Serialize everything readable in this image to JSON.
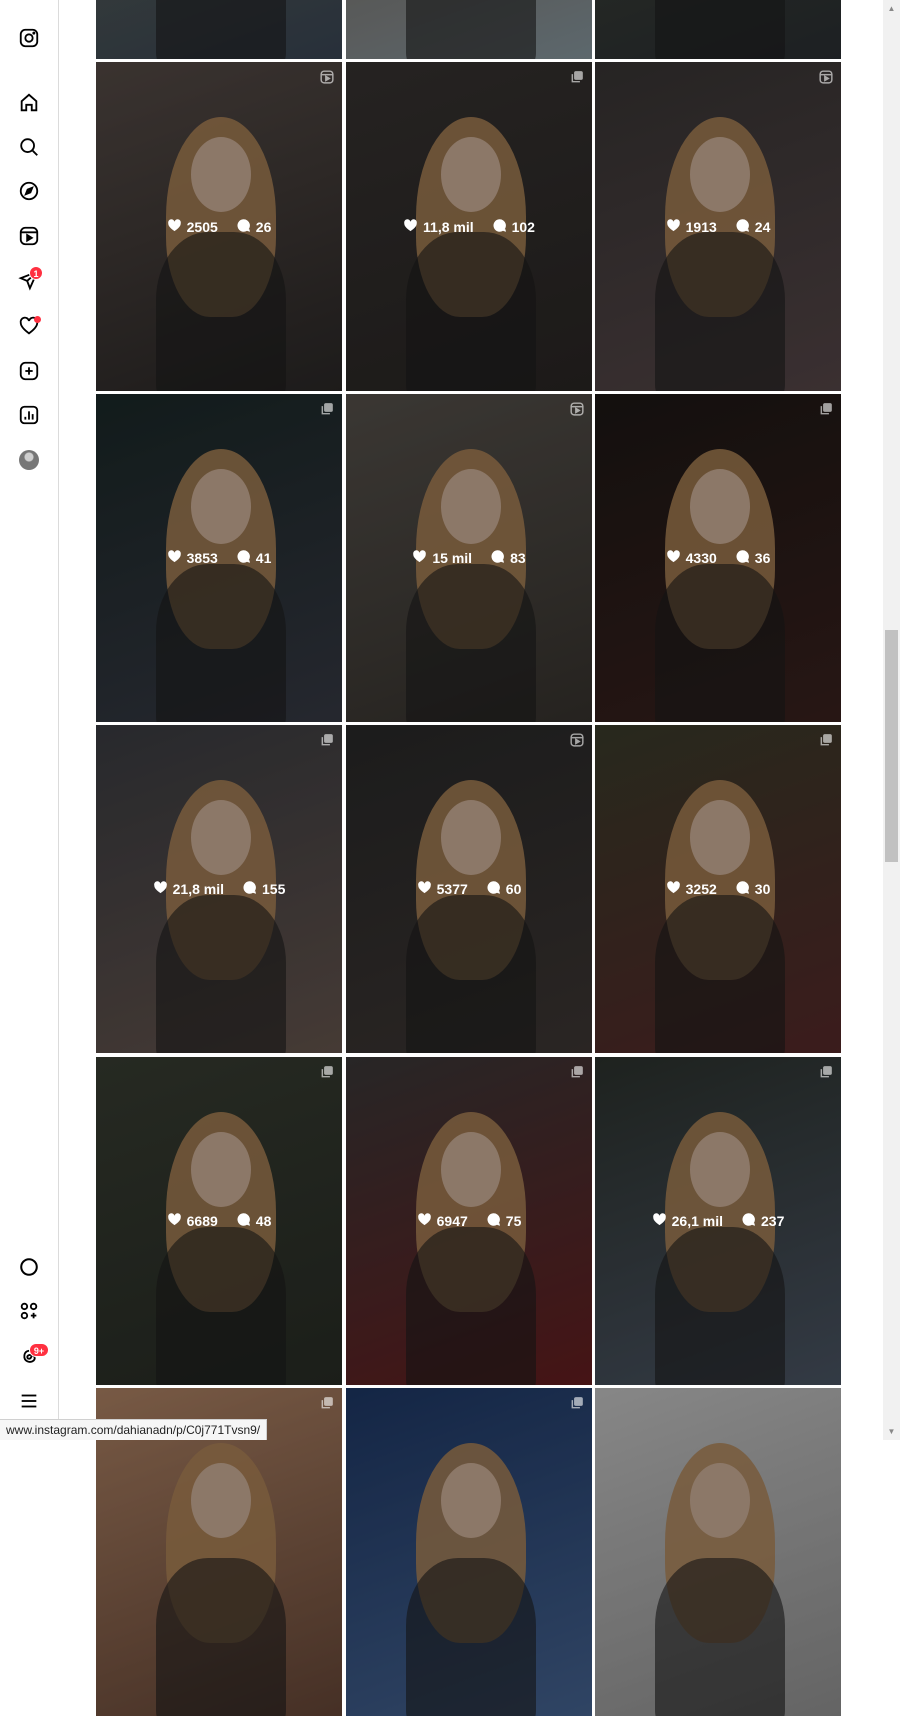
{
  "sidebar": {
    "top_icons": [
      "instagram-logo-icon",
      "home-icon",
      "search-icon",
      "explore-icon",
      "reels-icon",
      "messages-icon",
      "notifications-icon",
      "create-icon",
      "dashboard-icon",
      "profile-avatar"
    ],
    "messages_badge": "1",
    "bottom_icons": [
      "threads-circle-icon",
      "also-from-meta-icon",
      "threads-icon",
      "menu-icon"
    ],
    "threads_badge": "9+"
  },
  "posts": [
    {
      "likes": "",
      "comments": "",
      "type": "none"
    },
    {
      "likes": "",
      "comments": "",
      "type": "none"
    },
    {
      "likes": "",
      "comments": "",
      "type": "none"
    },
    {
      "likes": "2505",
      "comments": "26",
      "type": "reel"
    },
    {
      "likes": "11,8 mil",
      "comments": "102",
      "type": "carousel"
    },
    {
      "likes": "1913",
      "comments": "24",
      "type": "reel"
    },
    {
      "likes": "3853",
      "comments": "41",
      "type": "carousel"
    },
    {
      "likes": "15 mil",
      "comments": "83",
      "type": "reel"
    },
    {
      "likes": "4330",
      "comments": "36",
      "type": "carousel"
    },
    {
      "likes": "21,8 mil",
      "comments": "155",
      "type": "carousel"
    },
    {
      "likes": "5377",
      "comments": "60",
      "type": "reel"
    },
    {
      "likes": "3252",
      "comments": "30",
      "type": "carousel"
    },
    {
      "likes": "6689",
      "comments": "48",
      "type": "carousel"
    },
    {
      "likes": "6947",
      "comments": "75",
      "type": "carousel"
    },
    {
      "likes": "26,1 mil",
      "comments": "237",
      "type": "carousel"
    },
    {
      "likes": "",
      "comments": "",
      "type": "carousel"
    },
    {
      "likes": "",
      "comments": "",
      "type": "carousel"
    },
    {
      "likes": "",
      "comments": "",
      "type": "none"
    }
  ],
  "status_bar": {
    "url": "www.instagram.com/dahianadn/p/C0j771Tvsn9/"
  }
}
